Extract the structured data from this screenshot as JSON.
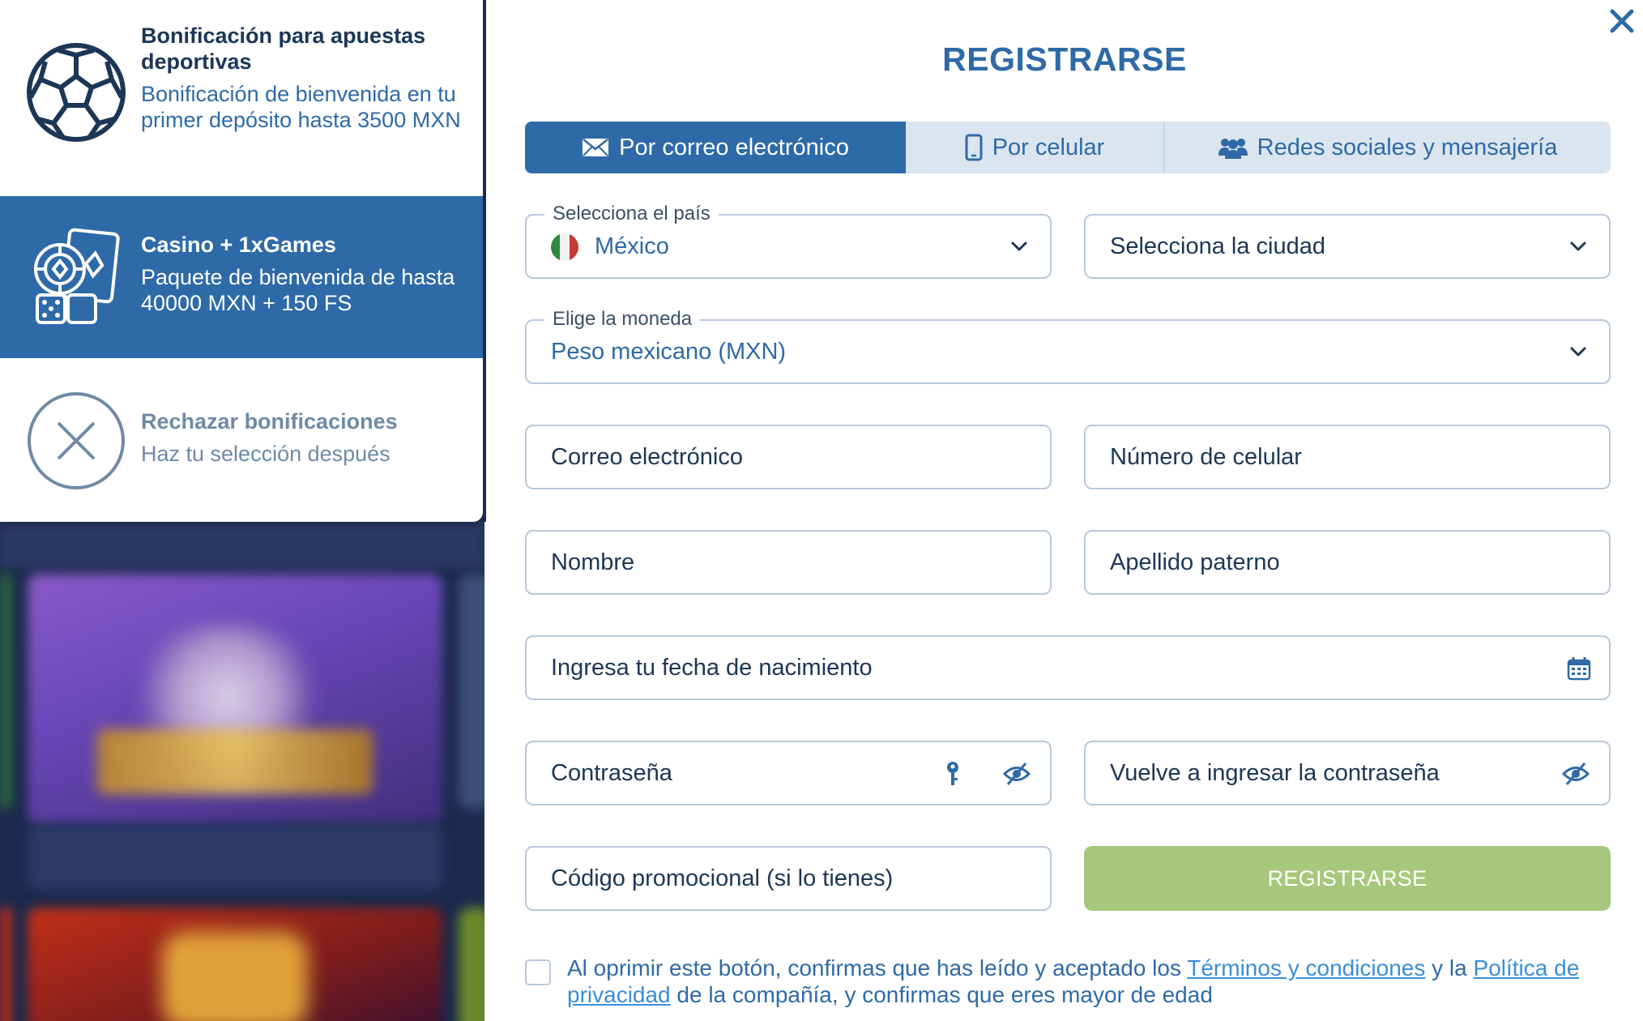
{
  "bonus_panel": {
    "options": [
      {
        "title": "Bonificación para apuestas deportivas",
        "description": "Bonificación de bienvenida en tu primer depósito hasta 3500 MXN",
        "icon": "soccer-ball-icon"
      },
      {
        "title": "Casino + 1xGames",
        "description": "Paquete de bienvenida de hasta 40000 MXN + 150 FS",
        "icon": "casino-chips-cards-icon",
        "selected": true
      },
      {
        "title": "Rechazar bonificaciones",
        "description": "Haz tu selección después",
        "icon": "decline-x-icon"
      }
    ]
  },
  "modal": {
    "title": "REGISTRARSE",
    "close_icon": "close-icon",
    "tabs": [
      {
        "label": "Por correo electrónico",
        "icon": "envelope-icon",
        "active": true
      },
      {
        "label": "Por celular",
        "icon": "phone-icon"
      },
      {
        "label": "Redes sociales y mensajería",
        "icon": "users-icon"
      }
    ],
    "country": {
      "legend": "Selecciona el país",
      "value": "México"
    },
    "city": {
      "placeholder": "Selecciona la ciudad"
    },
    "currency": {
      "legend": "Elige la moneda",
      "value": "Peso mexicano (MXN)"
    },
    "email": {
      "placeholder": "Correo electrónico"
    },
    "phone": {
      "placeholder": "Número de celular"
    },
    "first_name": {
      "placeholder": "Nombre"
    },
    "last_name": {
      "placeholder": "Apellido paterno"
    },
    "birthdate": {
      "placeholder": "Ingresa tu fecha de nacimiento"
    },
    "password": {
      "placeholder": "Contraseña"
    },
    "password_repeat": {
      "placeholder": "Vuelve a ingresar la contraseña"
    },
    "promo": {
      "placeholder": "Código promocional (si lo tienes)"
    },
    "submit_label": "REGISTRARSE",
    "terms": {
      "prefix": "Al oprimir este botón, confirmas que has leído y aceptado los ",
      "link1": "Términos y condiciones",
      "middle": " y la ",
      "link2": "Política de privacidad",
      "suffix": " de la compañía, y confirmas que eres mayor de edad",
      "checked": false
    }
  },
  "colors": {
    "brand_blue": "#2e6aa8",
    "dark_navy": "#1c3656",
    "submit_green": "#a6c87c",
    "tab_bg": "#dbe5ef",
    "link_blue": "#3b8ed6",
    "muted": "#6f8aa8"
  }
}
